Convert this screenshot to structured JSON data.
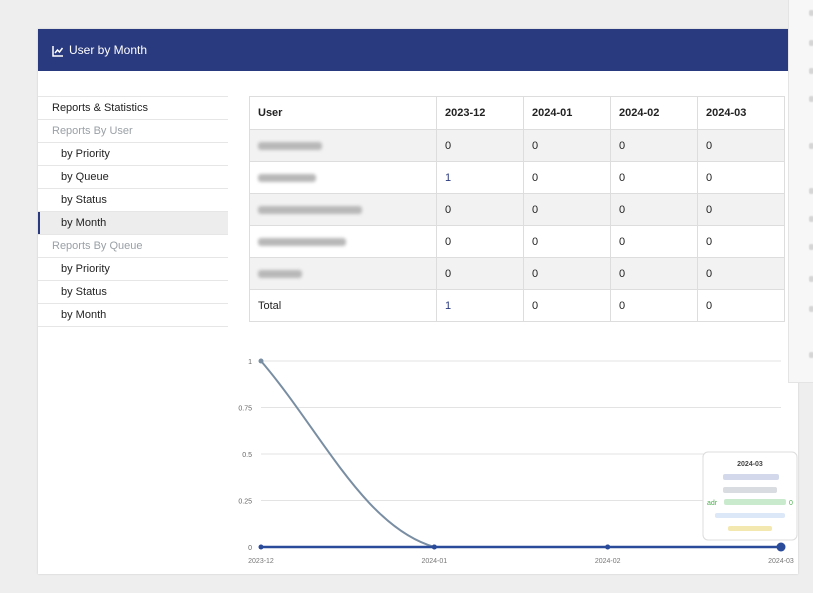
{
  "header": {
    "title": "User by Month",
    "icon": "line-chart-icon"
  },
  "sidebar": {
    "root": "Reports & Statistics",
    "groups": [
      {
        "label": "Reports By User",
        "items": [
          "by Priority",
          "by Queue",
          "by Status",
          "by Month"
        ]
      },
      {
        "label": "Reports By Queue",
        "items": [
          "by Priority",
          "by Status",
          "by Month"
        ]
      }
    ],
    "active": "by Month"
  },
  "table": {
    "headers": [
      "User",
      "2023-12",
      "2024-01",
      "2024-02",
      "2024-03"
    ],
    "rows": [
      {
        "user": "",
        "values": [
          "0",
          "0",
          "0",
          "0"
        ]
      },
      {
        "user": "",
        "values": [
          "1",
          "0",
          "0",
          "0"
        ]
      },
      {
        "user": "",
        "values": [
          "0",
          "0",
          "0",
          "0"
        ]
      },
      {
        "user": "",
        "values": [
          "0",
          "0",
          "0",
          "0"
        ]
      },
      {
        "user": "",
        "values": [
          "0",
          "0",
          "0",
          "0"
        ]
      }
    ],
    "total": {
      "label": "Total",
      "values": [
        "1",
        "0",
        "0",
        "0"
      ]
    }
  },
  "tooltip": {
    "title": "2024-03",
    "visible_text": "adr",
    "value": "0"
  },
  "chart_data": {
    "type": "line",
    "x": [
      "2023-12",
      "2024-01",
      "2024-02",
      "2024-03"
    ],
    "ylim": [
      0,
      1
    ],
    "yticks": [
      "0",
      "0.25",
      "0.5",
      "0.75",
      "1"
    ],
    "series": [
      {
        "values": [
          1,
          0,
          0,
          0
        ],
        "color": "#7a8ea3"
      },
      {
        "values": [
          0,
          0,
          0,
          0
        ],
        "color": "#2a4a9a"
      }
    ],
    "grid": true
  },
  "colors": {
    "header_bg": "#2a3a7f",
    "accent": "#2a3a7f"
  }
}
